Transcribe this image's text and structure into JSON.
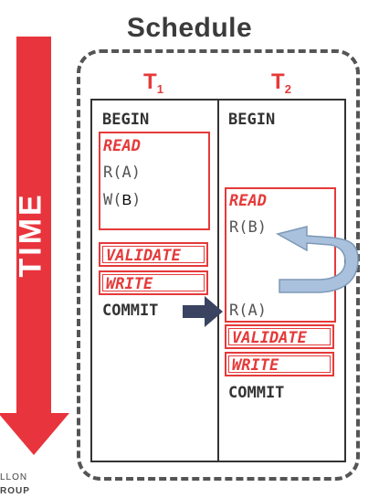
{
  "title": "Schedule",
  "side_label": "TIME",
  "transactions": [
    {
      "name": "T",
      "subscript": "1"
    },
    {
      "name": "T",
      "subscript": "2"
    }
  ],
  "t1": {
    "begin": "BEGIN",
    "read_label": "READ",
    "op_read": "R(A)",
    "op_write_prefix": "W(",
    "op_write_item": "B",
    "op_write_suffix": ")",
    "validate_label": "VALIDATE",
    "write_label": "WRITE",
    "commit": "COMMIT"
  },
  "t2": {
    "begin": "BEGIN",
    "read_label": "READ",
    "op_read_b": "R(B)",
    "op_read_a": "R(A)",
    "validate_label": "VALIDATE",
    "write_label": "WRITE",
    "commit": "COMMIT"
  },
  "logo": {
    "line1": "LLON",
    "line2": "ROUP"
  },
  "colors": {
    "accent_red": "#e53a3a",
    "time_arrow": "#e8343c",
    "commit_arrow": "#3a4460",
    "curved_arrow": "#a9c1dc"
  }
}
